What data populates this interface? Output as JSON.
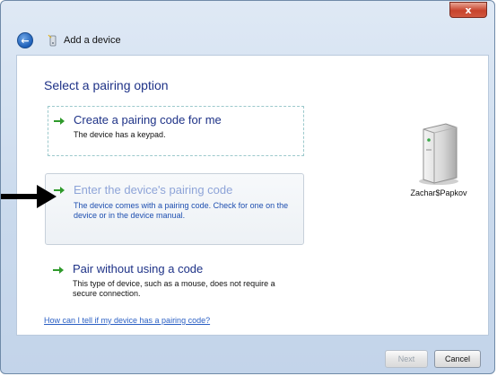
{
  "window": {
    "title": "Add a device",
    "close_label": "x"
  },
  "heading": "Select a pairing option",
  "options": [
    {
      "title": "Create a pairing code for me",
      "description": "The device has a keypad.",
      "state": "normal"
    },
    {
      "title": "Enter the device's pairing code",
      "description": "The device comes with a pairing code. Check for one on the device or in the device manual.",
      "state": "hovered"
    },
    {
      "title": "Pair without using a code",
      "description": "This type of device, such as a mouse, does not require a secure connection.",
      "state": "normal"
    }
  ],
  "help_link": "How can I tell if my device has a pairing code?",
  "device": {
    "name": "Zachar$Papkov",
    "icon": "pc-tower-icon"
  },
  "buttons": {
    "next": "Next",
    "cancel": "Cancel",
    "next_enabled": false
  },
  "colors": {
    "accent_text": "#1e3287",
    "hover_text": "#8ea4d8",
    "link": "#2a5fc4",
    "arrow_green": "#2f9a2b"
  }
}
